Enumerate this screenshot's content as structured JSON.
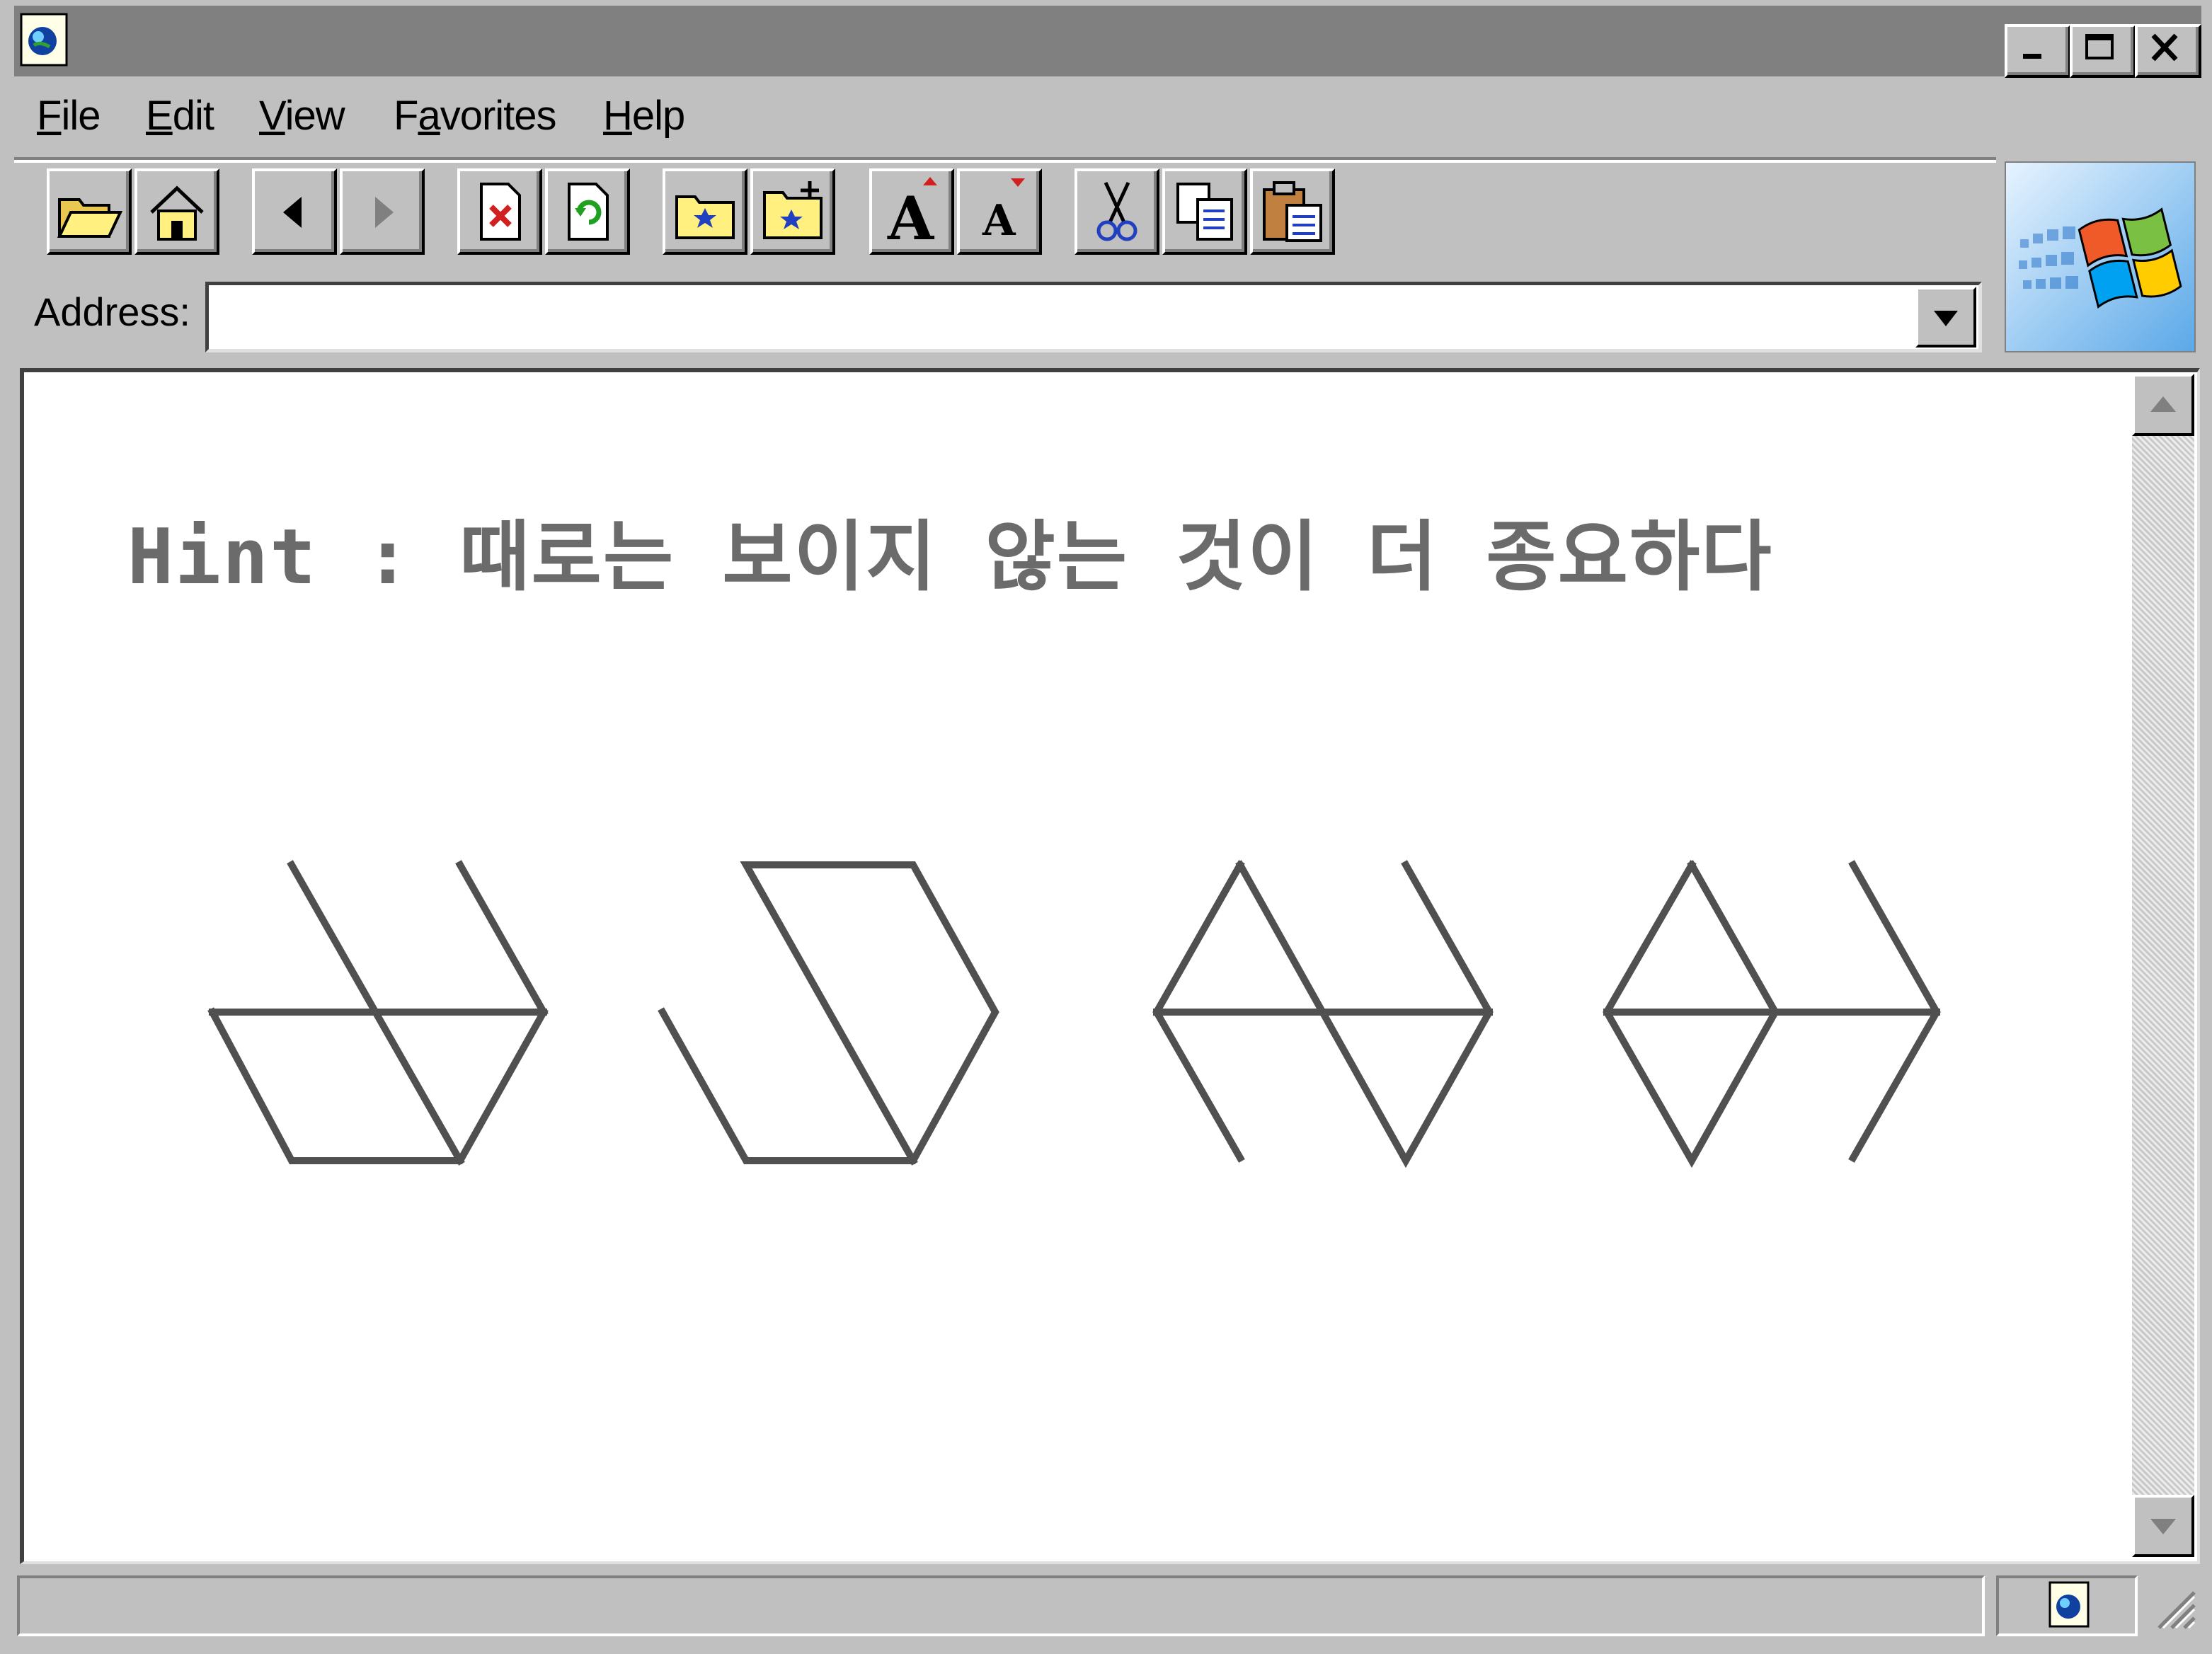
{
  "window": {
    "title": "",
    "icons": {
      "app": "globe-page-icon",
      "minimize": "minimize-icon",
      "maximize": "maximize-icon",
      "close": "close-icon"
    }
  },
  "menu": {
    "items": [
      {
        "label": "File",
        "accel": "F",
        "rest": "ile"
      },
      {
        "label": "Edit",
        "accel": "E",
        "rest": "dit"
      },
      {
        "label": "View",
        "accel": "V",
        "rest": "iew"
      },
      {
        "label": "Favorites",
        "pre": "F",
        "accel": "a",
        "rest": "vorites"
      },
      {
        "label": "Help",
        "accel": "H",
        "rest": "elp"
      }
    ]
  },
  "toolbar": {
    "buttons": [
      {
        "name": "open-folder-icon"
      },
      {
        "name": "home-icon"
      },
      {
        "name": "back-icon"
      },
      {
        "name": "forward-icon"
      },
      {
        "name": "stop-icon"
      },
      {
        "name": "refresh-icon"
      },
      {
        "name": "favorites-folder-icon"
      },
      {
        "name": "add-favorite-icon"
      },
      {
        "name": "font-larger-icon"
      },
      {
        "name": "font-smaller-icon"
      },
      {
        "name": "cut-icon"
      },
      {
        "name": "copy-icon"
      },
      {
        "name": "paste-icon"
      }
    ]
  },
  "address": {
    "label": "Address:",
    "value": ""
  },
  "content": {
    "hint": "Hint : 때로는 보이지 않는 것이 더 종요하다",
    "line_color": "#505050",
    "hint_color": "#6b6b6b"
  },
  "colors": {
    "chrome": "#c0c0c0",
    "titlebar": "#808080",
    "content_bg": "#ffffff"
  }
}
